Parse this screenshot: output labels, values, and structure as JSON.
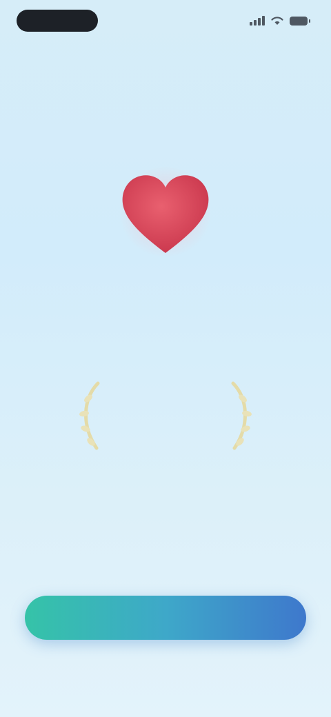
{
  "status_bar": {
    "time": "",
    "icons": [
      "signal-icon",
      "wifi-icon",
      "battery-icon"
    ]
  },
  "hero": {
    "icon": "heart-icon",
    "app_name_part1": "",
    "app_name_part2": "",
    "tagline": ""
  },
  "award": {
    "icon": "laurel-icon",
    "title": "",
    "subtitle": ""
  },
  "cta": {
    "label": ""
  },
  "footer": {
    "link_text": ""
  },
  "colors": {
    "heart": "#d9495e",
    "accent_blue": "#58b4e8",
    "button_gradient_start": "#35c3a8",
    "button_gradient_end": "#3e78cc",
    "laurel": "#e4dba8",
    "background": "#d6edf8"
  }
}
